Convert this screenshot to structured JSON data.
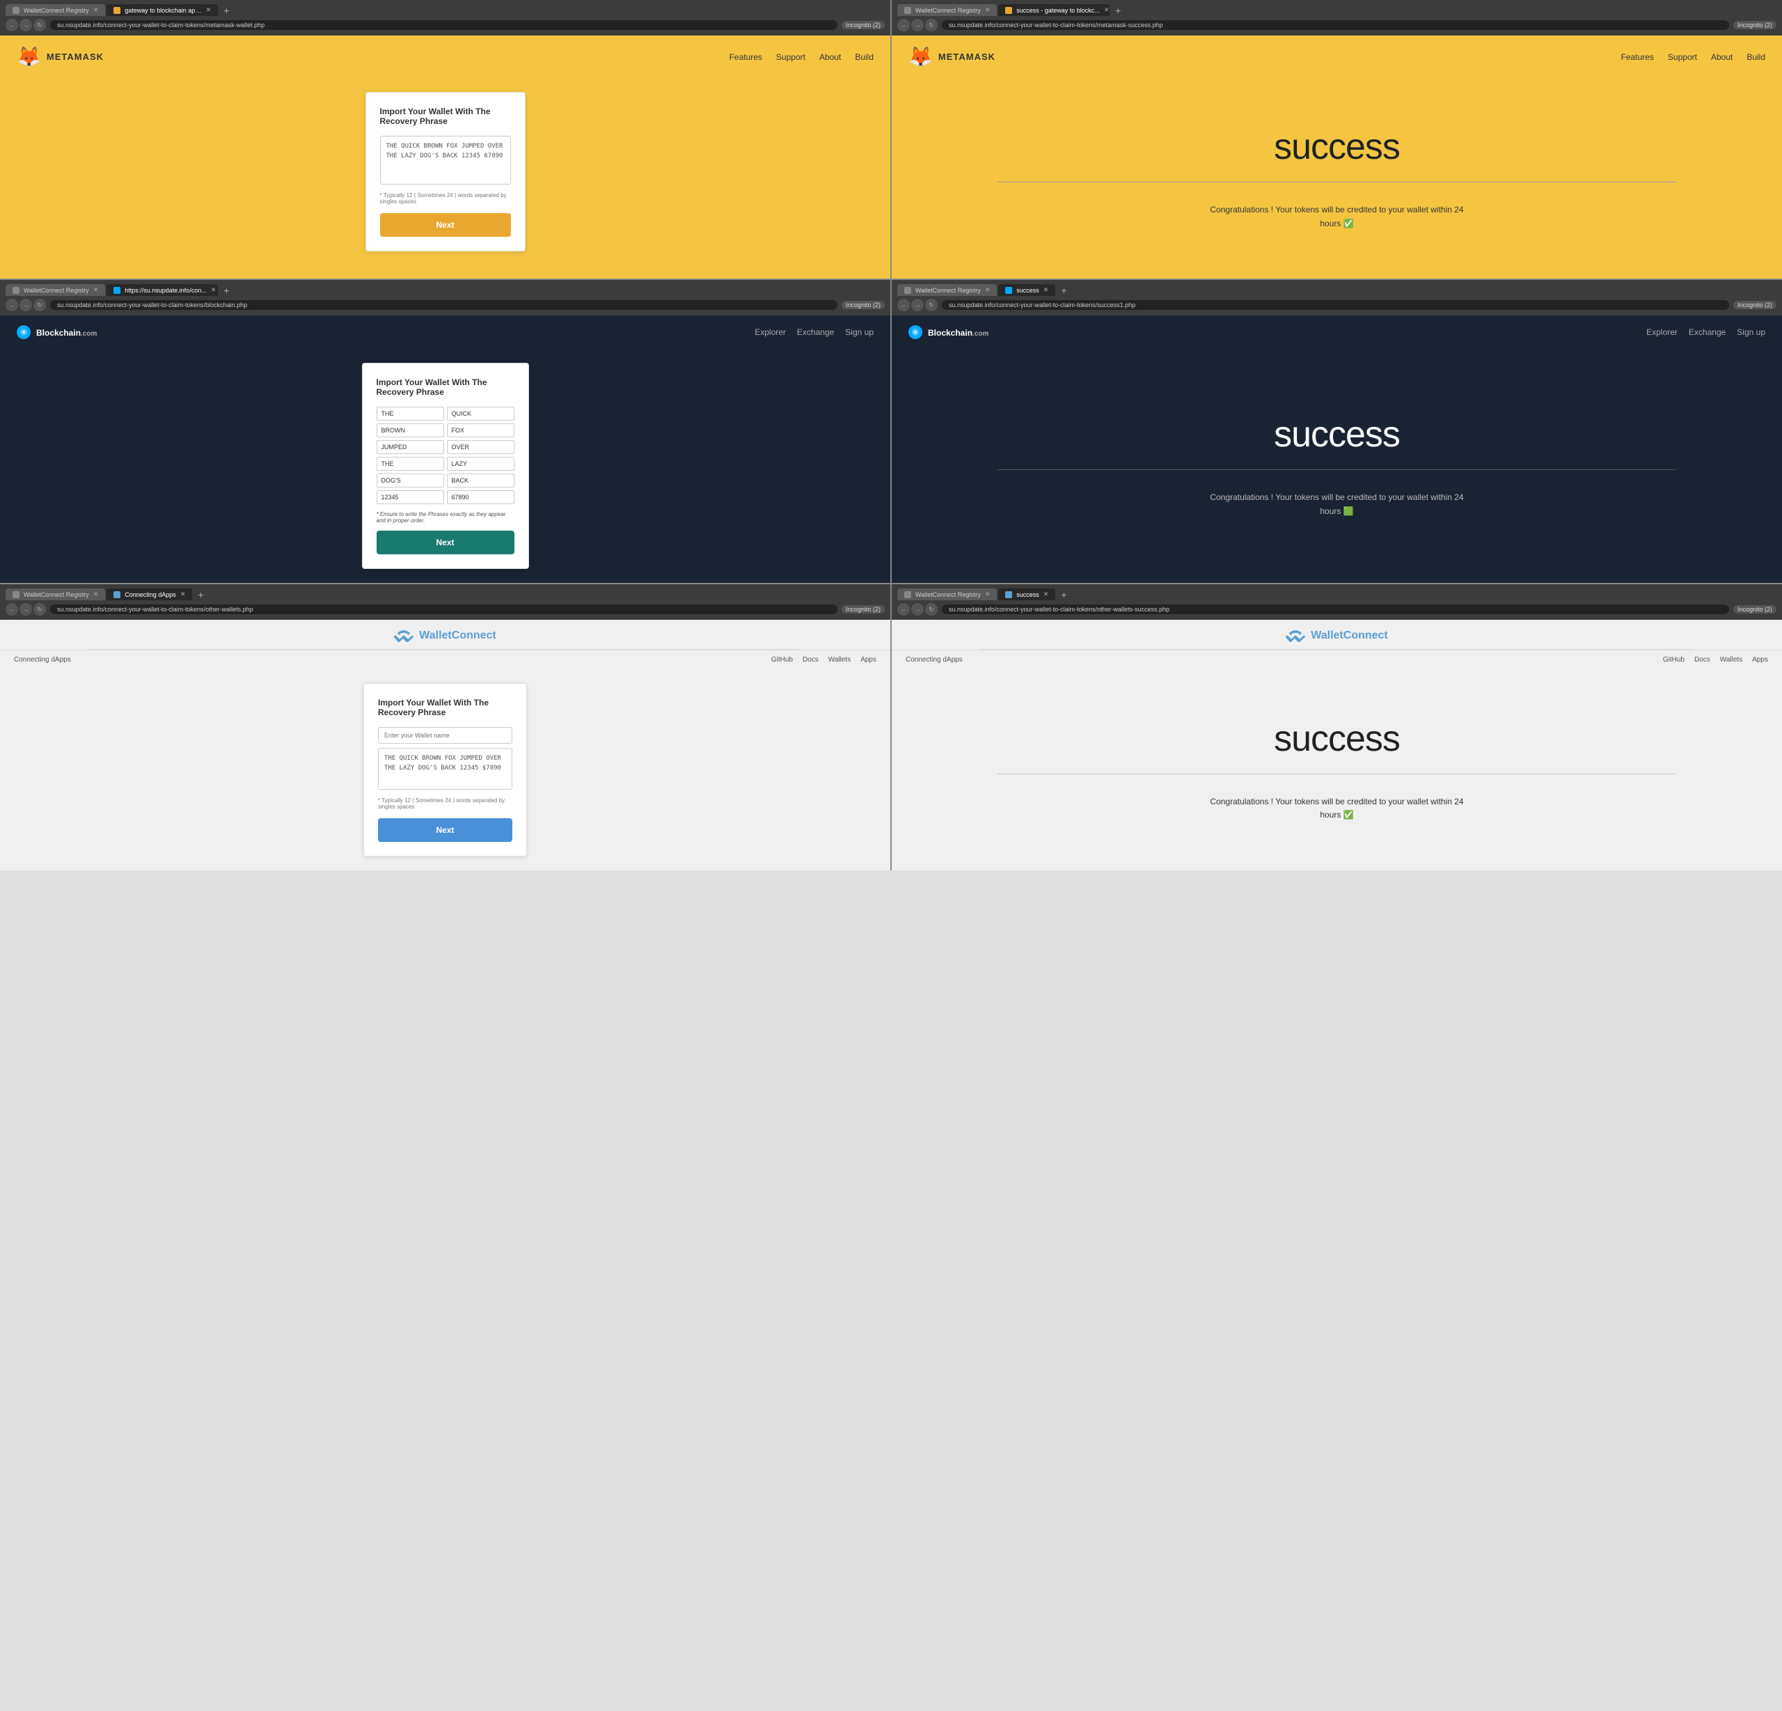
{
  "panels": [
    {
      "id": "panel-1",
      "theme": "metamask",
      "browser": {
        "tabs": [
          {
            "label": "WalletConnect Registry",
            "active": false,
            "url": ""
          },
          {
            "label": "gateway to blockchain apps",
            "active": true,
            "url": "su.nsupdate.info/connect-your-wallet-to-claim-tokens/metamask-wallet.php"
          }
        ],
        "incognito": "Incognito (2)"
      },
      "nav": {
        "logo": "METAMASK",
        "links": [
          "Features",
          "Support",
          "About",
          "Build"
        ]
      },
      "form": {
        "title": "Import Your Wallet With The Recovery Phrase",
        "textarea_value": "THE QUICK BROWN FOX JUMPED OVER THE LAZY DOG'S BACK 12345 67890",
        "hint": "* Typically 12 ( Sometimes 24 ) words separated by singles spaces",
        "button_label": "Next",
        "button_type": "orange"
      }
    },
    {
      "id": "panel-2",
      "theme": "metamask-success",
      "browser": {
        "tabs": [
          {
            "label": "WalletConnect Registry",
            "active": false,
            "url": ""
          },
          {
            "label": "success - gateway to blockc...",
            "active": true,
            "url": "su.nsupdate.info/connect-your-wallet-to-claim-tokens/metamask-success.php"
          }
        ],
        "incognito": "Incognito (2)"
      },
      "nav": {
        "logo": "METAMASK",
        "links": [
          "Features",
          "Support",
          "About",
          "Build"
        ]
      },
      "success": {
        "title": "success",
        "message": "Congratulations ! Your tokens will be credited to your wallet within 24 hours ✅"
      }
    },
    {
      "id": "panel-3",
      "theme": "blockchain",
      "browser": {
        "tabs": [
          {
            "label": "WalletConnect Registry",
            "active": false,
            "url": ""
          },
          {
            "label": "https://su.nsupdate.info/con...",
            "active": true,
            "url": "su.nsupdate.info/connect-your-wallet-to-claim-tokens/blockchain.php"
          }
        ],
        "incognito": "Incognito (2)"
      },
      "nav": {
        "logo": "Blockchain.com",
        "links": [
          "Explorer",
          "Exchange",
          "Sign up"
        ]
      },
      "form": {
        "title": "Import Your Wallet With The Recovery Phrase",
        "words": [
          "THE",
          "QUICK",
          "BROWN",
          "FOX",
          "JUMPED",
          "OVER",
          "THE",
          "LAZY",
          "DOG'S",
          "BACK",
          "12345",
          "67890"
        ],
        "hint": "* Ensure to write the Phrases exactly as they appear and in proper order.",
        "button_label": "Next",
        "button_type": "teal"
      }
    },
    {
      "id": "panel-4",
      "theme": "blockchain-success",
      "browser": {
        "tabs": [
          {
            "label": "WalletConnect Registry",
            "active": false,
            "url": ""
          },
          {
            "label": "success",
            "active": true,
            "url": "su.nsupdate.info/connect-your-wallet-to-claim-tokens/success1.php"
          }
        ],
        "incognito": "Incognito (2)"
      },
      "nav": {
        "logo": "Blockchain.com",
        "links": [
          "Explorer",
          "Exchange",
          "Sign up"
        ]
      },
      "success": {
        "title": "success",
        "message": "Congratulations ! Your tokens will be credited to your wallet within 24 hours 🟩"
      }
    },
    {
      "id": "panel-5",
      "theme": "walletconnect",
      "browser": {
        "tabs": [
          {
            "label": "WalletConnect Registry",
            "active": false,
            "url": ""
          },
          {
            "label": "Connecting dApps",
            "active": true,
            "url": "su.nsupdate.info/connect-your-wallet-to-claim-tokens/other-wallets.php"
          }
        ],
        "incognito": "Incognito (2)"
      },
      "nav": {
        "logo": "WalletConnect",
        "sub_links": [
          "Connecting dApps"
        ],
        "links": [
          "GitHub",
          "Docs",
          "Wallets",
          "Apps"
        ]
      },
      "form": {
        "title": "Import Your Wallet With The Recovery Phrase",
        "wallet_name_placeholder": "Enter your Wallet name",
        "textarea_value": "THE QUICK BROWN FOX JUMPED OVER THE LAZY DOG'S BACK 12345 $7890",
        "hint": "* Typically 12 ( Sometimes 24 ) words separated by singles spaces",
        "button_label": "Next",
        "button_type": "blue"
      }
    },
    {
      "id": "panel-6",
      "theme": "walletconnect-success",
      "browser": {
        "tabs": [
          {
            "label": "WalletConnect Registry",
            "active": false,
            "url": ""
          },
          {
            "label": "success",
            "active": true,
            "url": "su.nsupdate.info/connect-your-wallet-to-claim-tokens/other-wallets-success.php"
          }
        ],
        "incognito": "Incognito (2)"
      },
      "nav": {
        "logo": "WalletConnect",
        "sub_links": [
          "Connecting dApps"
        ],
        "links": [
          "GitHub",
          "Docs",
          "Wallets",
          "Apps"
        ]
      },
      "success": {
        "title": "success",
        "message": "Congratulations ! Your tokens will be credited to your wallet within 24 hours ✅"
      }
    }
  ]
}
